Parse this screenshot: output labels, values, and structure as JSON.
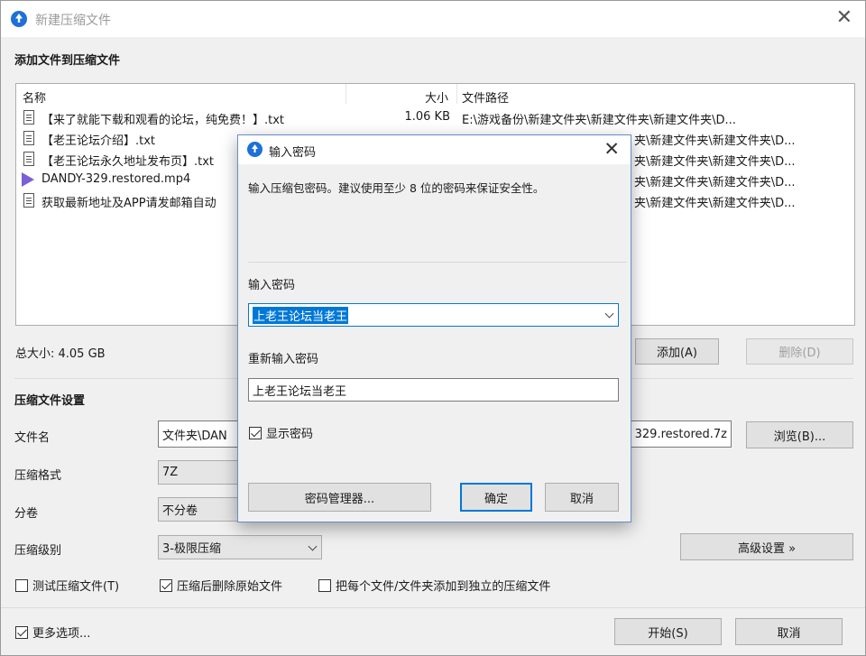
{
  "window": {
    "title": "新建压缩文件"
  },
  "files_section": {
    "title": "添加文件到压缩文件",
    "columns": {
      "name": "名称",
      "size": "大小",
      "path": "文件路径"
    },
    "rows": [
      {
        "name": "【来了就能下载和观看的论坛，纯免费！】.txt",
        "size": "1.06 KB",
        "path": "E:\\游戏备份\\新建文件夹\\新建文件夹\\新建文件夹\\D...",
        "icon": "text-file-icon"
      },
      {
        "name": "【老王论坛介绍】.txt",
        "size": "",
        "path": "夹\\新建文件夹\\新建文件夹\\D...",
        "icon": "text-file-icon"
      },
      {
        "name": "【老王论坛永久地址发布页】.txt",
        "size": "",
        "path": "夹\\新建文件夹\\新建文件夹\\D...",
        "icon": "text-file-icon"
      },
      {
        "name": "DANDY-329.restored.mp4",
        "size": "",
        "path": "夹\\新建文件夹\\新建文件夹\\D...",
        "icon": "video-file-icon"
      },
      {
        "name": "获取最新地址及APP请发邮箱自动",
        "size": "",
        "path": "夹\\新建文件夹\\新建文件夹\\D...",
        "icon": "text-file-icon"
      }
    ],
    "total_size": "总大小: 4.05 GB",
    "add_button": "添加(A)",
    "delete_button": "删除(D)"
  },
  "settings": {
    "title": "压缩文件设置",
    "filename_label": "文件名",
    "filename_value_left": "文件夹\\DAN",
    "filename_value_right": "329.restored.7z",
    "browse_button": "浏览(B)...",
    "format_label": "压缩格式",
    "format_value": "7Z",
    "split_label": "分卷",
    "split_value": "不分卷",
    "level_label": "压缩级别",
    "level_value": "3-极限压缩",
    "advanced_button": "高级设置 »",
    "test_checkbox": "测试压缩文件(T)",
    "delete_after_checkbox": "压缩后删除原始文件",
    "each_separately_checkbox": "把每个文件/文件夹添加到独立的压缩文件",
    "more_options_checkbox": "更多选项...",
    "start_button": "开始(S)",
    "cancel_button": "取消"
  },
  "dialog": {
    "title": "输入密码",
    "description": "输入压缩包密码。建议使用至少 8 位的密码来保证安全性。",
    "password_label": "输入密码",
    "password_value": "上老王论坛当老王",
    "confirm_label": "重新输入密码",
    "confirm_value": "上老王论坛当老王",
    "show_password": "显示密码",
    "manager_button": "密码管理器...",
    "ok_button": "确定",
    "cancel_button": "取消"
  }
}
